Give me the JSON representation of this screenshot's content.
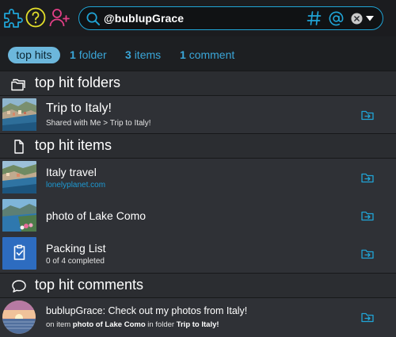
{
  "topbar": {
    "icons": [
      "puzzle-icon",
      "help-circle-icon",
      "add-user-icon"
    ],
    "colors": {
      "puzzle": "#20a4d6",
      "help": "#e3df2a",
      "add_user": "#e23f86"
    }
  },
  "search": {
    "query": "@bublupGrace",
    "icons": [
      "search-icon",
      "hashtag-icon",
      "at-icon",
      "clear-icon",
      "dropdown-caret-icon"
    ]
  },
  "filters": {
    "active_label": "top hits",
    "folder": {
      "count": "1",
      "label": "folder"
    },
    "items": {
      "count": "3",
      "label": "items"
    },
    "comment": {
      "count": "1",
      "label": "comment"
    }
  },
  "sections": {
    "folders": {
      "title": "top hit folders",
      "icon": "folder-icon"
    },
    "items": {
      "title": "top hit items",
      "icon": "document-icon"
    },
    "comments": {
      "title": "top hit comments",
      "icon": "chat-bubble-icon"
    }
  },
  "folder_rows": [
    {
      "title": "Trip to Italy!",
      "subtitle": "Shared with Me > Trip to Italy!"
    }
  ],
  "item_rows": [
    {
      "title": "Italy travel",
      "link": "lonelyplanet.com"
    },
    {
      "title": "photo of Lake Como"
    },
    {
      "title": "Packing List",
      "subtitle": "0 of 4 completed"
    }
  ],
  "comment_rows": [
    {
      "text": "bublupGrace: Check out my photos from Italy!",
      "prefix": "on item ",
      "item": "photo of Lake Como",
      "middle": " in folder ",
      "folder": "Trip to Italy!"
    }
  ],
  "accent_color": "#20a4d6"
}
